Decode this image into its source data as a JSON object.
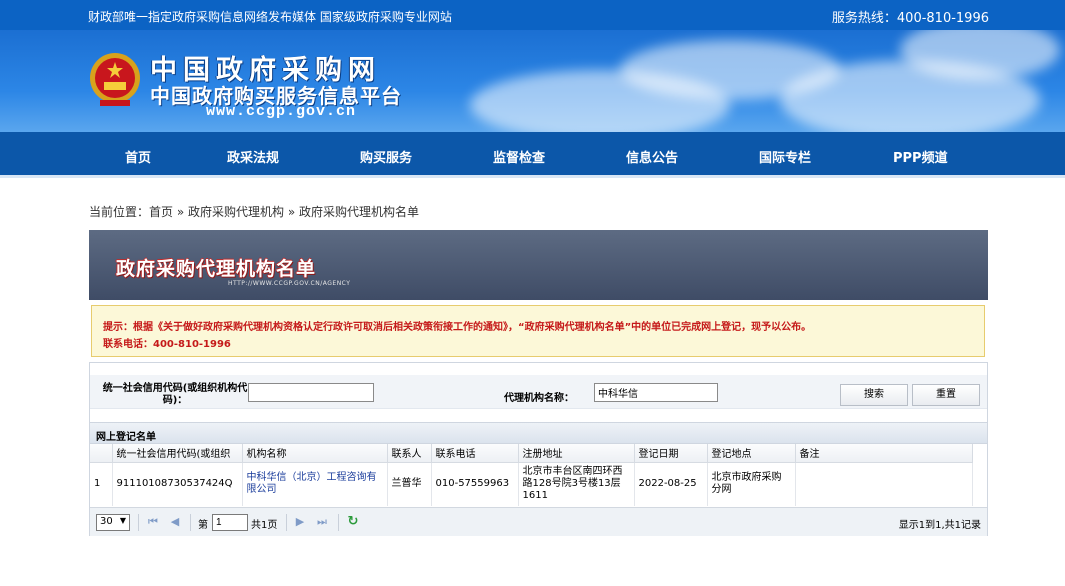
{
  "topbar": {
    "left_text": "财政部唯一指定政府采购信息网络发布媒体 国家级政府采购专业网站",
    "hotline": "服务热线：400-810-1996"
  },
  "banner": {
    "title_main": "中国政府采购网",
    "title_sub": "中国政府购买服务信息平台",
    "url": "www.ccgp.gov.cn"
  },
  "nav": [
    "首页",
    "政采法规",
    "购买服务",
    "监督检查",
    "信息公告",
    "国际专栏",
    "PPP频道"
  ],
  "breadcrumb": {
    "prefix": "当前位置：",
    "items": [
      "首页",
      "政府采购代理机构",
      "政府采购代理机构名单"
    ],
    "sep": " » "
  },
  "agency_banner": {
    "title": "政府采购代理机构名单",
    "url": "HTTP://WWW.CCGP.GOV.CN/AGENCY"
  },
  "notice": {
    "line1": "提示：根据《关于做好政府采购代理机构资格认定行政许可取消后相关政策衔接工作的通知》，“政府采购代理机构名单”中的单位已完成网上登记，现予以公布。",
    "line2": "联系电话：400-810-1996"
  },
  "search": {
    "code_label": "统一社会信用代码(或组织机构代码)：",
    "code_value": "",
    "name_label": "代理机构名称：",
    "name_value": "中科华信",
    "search_button": "搜索",
    "reset_button": "重置"
  },
  "list": {
    "title": "网上登记名单",
    "columns": [
      "",
      "统一社会信用代码(或组织",
      "机构名称",
      "联系人",
      "联系电话",
      "注册地址",
      "登记日期",
      "登记地点",
      "备注"
    ],
    "rows": [
      [
        "1",
        "91110108730537424Q",
        "中科华信（北京）工程咨询有限公司",
        "兰普华",
        "010-57559963",
        "北京市丰台区南四环西路128号院3号楼13层1611",
        "2022-08-25",
        "北京市政府采购分网",
        ""
      ]
    ]
  },
  "pager": {
    "page_size": "30",
    "page_label_before": "第",
    "page_value": "1",
    "page_label_after": "共1页",
    "summary": "显示1到1,共1记录"
  }
}
